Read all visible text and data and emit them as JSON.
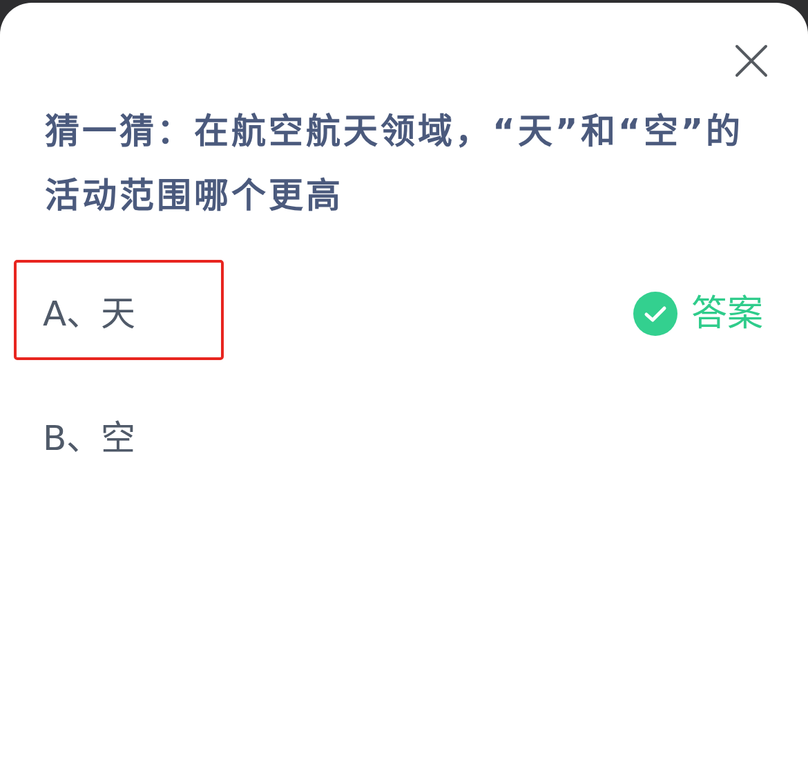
{
  "dialog": {
    "title": "猜一猜：在航空航天领域，“天”和“空”的活动范围哪个更高",
    "options": [
      {
        "label": "A、天",
        "highlighted": true,
        "answer_tag": "答案"
      },
      {
        "label": "B、空",
        "highlighted": false
      }
    ]
  }
}
